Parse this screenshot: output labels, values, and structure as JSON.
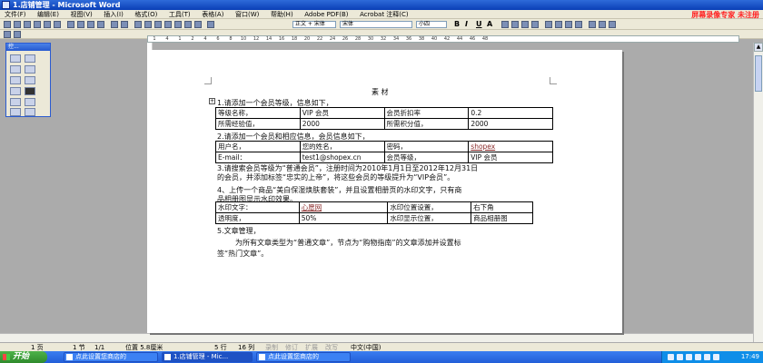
{
  "window": {
    "title": "1.店铺管理 - Microsoft Word"
  },
  "watermark": "屏幕录像专家 未注册",
  "menu": [
    "文件(F)",
    "编辑(E)",
    "视图(V)",
    "插入(I)",
    "格式(O)",
    "工具(T)",
    "表格(A)",
    "窗口(W)",
    "帮助(H)",
    "Adobe PDF(B)",
    "Acrobat 注释(C)"
  ],
  "toolbar": {
    "style": "正文 + 宋体",
    "font": "宋体",
    "size": "小四",
    "bold": "B",
    "italic": "I",
    "underline": "U",
    "charscale": "A"
  },
  "ruler_ticks": [
    "1",
    "4",
    "1",
    "2",
    "4",
    "6",
    "8",
    "10",
    "12",
    "14",
    "16",
    "18",
    "20",
    "22",
    "24",
    "26",
    "28",
    "30",
    "32",
    "34",
    "36",
    "38",
    "40",
    "42",
    "44",
    "46",
    "48"
  ],
  "palette": {
    "title": "控..."
  },
  "doc": {
    "heading": "素 材",
    "item1": "1.请添加一个会员等级，信息如下，",
    "table1": [
      [
        "等级名称，",
        "VIP 会员",
        "会员折扣率",
        "0.2"
      ],
      [
        "所需经验值，",
        "2000",
        "所需积分值，",
        "2000"
      ]
    ],
    "item2": "2.请添加一个会员和相应信息，会员信息如下，",
    "table2": [
      [
        "用户名，",
        "您的姓名，",
        "密码，",
        "shopex"
      ],
      [
        "E-mail：",
        "test1@shopex.cn",
        "会员等级，",
        "VIP 会员"
      ]
    ],
    "item3_l1": "3.请搜索会员等级为“普通会员”，注册时间为2010年1月1日至2012年12月31日",
    "item3_l2": "的会员，并添加标签“忠实的上帝”，将这些会员的等级提升为“VIP会员”。",
    "item4_l1": "4、上传一个商品“美白保湿焕肤套装”，并且设置相册页的水印文字，只有商",
    "item4_l2": "品相册图显示水印效果。",
    "table3": [
      [
        "水印文字：",
        "心愿网",
        "水印位置设置，",
        "右下角"
      ],
      [
        "透明度，",
        "50%",
        "水印显示位置，",
        "商品相册图"
      ]
    ],
    "item5": "5.文章管理，",
    "item5_l1": "为所有文章类型为“普通文章”，节点为“购物指南”的文章添加并设置标",
    "item5_l2": "签“热门文章”。"
  },
  "status": {
    "page": "1 页",
    "section": "1 节",
    "pages": "1/1",
    "position": "位置 5.8厘米",
    "line": "5 行",
    "col": "16 列",
    "rec": "录制",
    "trk": "修订",
    "ext": "扩展",
    "ovr": "改写",
    "lang": "中文(中国)"
  },
  "taskbar": {
    "start": "开始",
    "buttons": [
      "点此设置您商店的",
      "1.店铺管理 - Mic...",
      "点此设置您商店的"
    ],
    "clock": "17:49"
  }
}
